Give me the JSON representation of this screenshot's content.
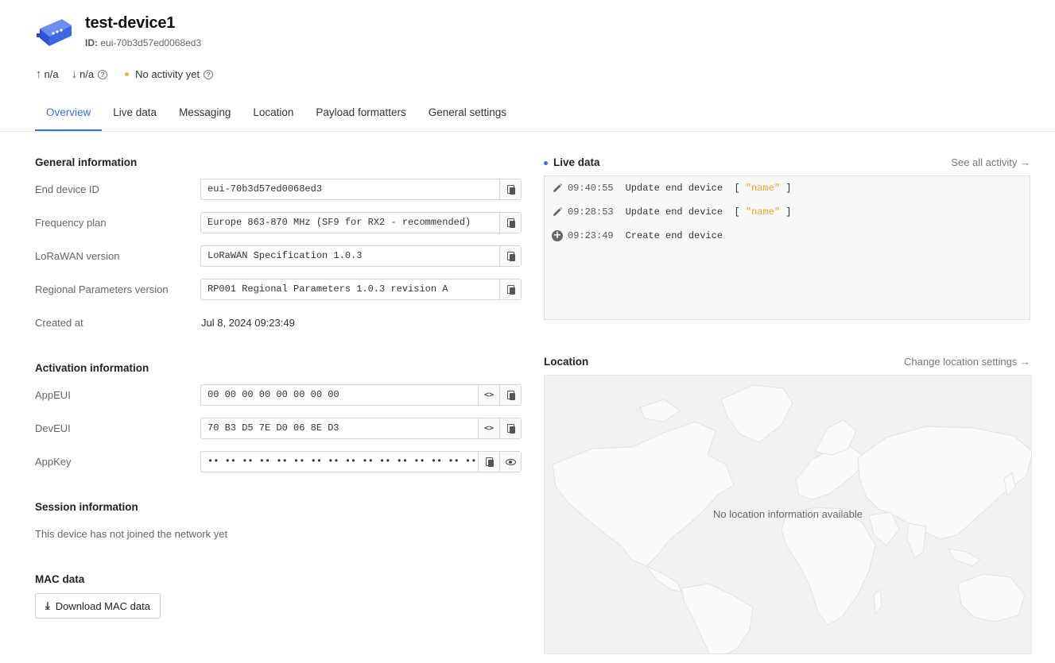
{
  "device": {
    "title": "test-device1",
    "id_label": "ID:",
    "id_value": "eui-70b3d57ed0068ed3"
  },
  "stats": {
    "uplink": "n/a",
    "downlink": "n/a",
    "activity": "No activity yet",
    "activity_color": "#f2b33d"
  },
  "tabs": [
    {
      "label": "Overview",
      "active": true
    },
    {
      "label": "Live data"
    },
    {
      "label": "Messaging"
    },
    {
      "label": "Location"
    },
    {
      "label": "Payload formatters"
    },
    {
      "label": "General settings"
    }
  ],
  "general": {
    "title": "General information",
    "end_device_id_label": "End device ID",
    "end_device_id": "eui-70b3d57ed0068ed3",
    "frequency_plan_label": "Frequency plan",
    "frequency_plan": "Europe 863-870 MHz (SF9 for RX2 - recommended)",
    "lorawan_version_label": "LoRaWAN version",
    "lorawan_version": "LoRaWAN Specification 1.0.3",
    "regional_params_label": "Regional Parameters version",
    "regional_params": "RP001 Regional Parameters 1.0.3 revision A",
    "created_at_label": "Created at",
    "created_at": "Jul 8, 2024 09:23:49"
  },
  "activation": {
    "title": "Activation information",
    "app_eui_label": "AppEUI",
    "app_eui": "00 00 00 00 00 00 00 00",
    "dev_eui_label": "DevEUI",
    "dev_eui": "70 B3 D5 7E D0 06 8E D3",
    "app_key_label": "AppKey",
    "app_key": "•• •• •• •• •• •• •• •• •• •• •• •• •• •• •• ••"
  },
  "session": {
    "title": "Session information",
    "text": "This device has not joined the network yet"
  },
  "mac": {
    "title": "MAC data",
    "download_label": "Download MAC data"
  },
  "live": {
    "title": "Live data",
    "link": "See all activity →",
    "events": [
      {
        "icon": "pencil-icon",
        "time": "09:40:55",
        "text": "Update end device",
        "open": "[ ",
        "field": "\"name\"",
        "close": " ]"
      },
      {
        "icon": "pencil-icon",
        "time": "09:28:53",
        "text": "Update end device",
        "open": "[ ",
        "field": "\"name\"",
        "close": " ]"
      },
      {
        "icon": "plus-circle-icon",
        "time": "09:23:49",
        "text": "Create end device",
        "open": "",
        "field": "",
        "close": ""
      }
    ]
  },
  "location": {
    "title": "Location",
    "link": "Change location settings →",
    "empty_text": "No location information available"
  },
  "colors": {
    "accent": "#3a6ee6",
    "string_token": "#e8a23a"
  }
}
